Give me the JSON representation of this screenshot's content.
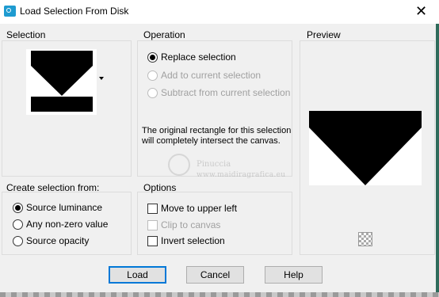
{
  "window": {
    "title": "Load Selection From Disk",
    "close_glyph": "✕",
    "app_icon": "camera-app-icon"
  },
  "selection_group": {
    "label": "Selection",
    "thumbnail_icon": "selection-thumbnail-image"
  },
  "operation_group": {
    "label": "Operation",
    "options": [
      {
        "label": "Replace selection",
        "checked": true,
        "enabled": true
      },
      {
        "label": "Add to current selection",
        "checked": false,
        "enabled": false
      },
      {
        "label": "Subtract from current selection",
        "checked": false,
        "enabled": false
      }
    ],
    "note": "The original rectangle for this selection will completely intersect the canvas."
  },
  "preview_group": {
    "label": "Preview",
    "background_toggle_icon": "checkerboard-icon"
  },
  "create_group": {
    "label": "Create selection from:",
    "options": [
      {
        "label": "Source luminance",
        "checked": true
      },
      {
        "label": "Any non-zero value",
        "checked": false
      },
      {
        "label": "Source opacity",
        "checked": false
      }
    ]
  },
  "options_group": {
    "label": "Options",
    "checkboxes": [
      {
        "label": "Move to upper left",
        "checked": false,
        "enabled": true
      },
      {
        "label": "Clip to canvas",
        "checked": false,
        "enabled": false
      },
      {
        "label": "Invert selection",
        "checked": false,
        "enabled": true
      }
    ]
  },
  "buttons": {
    "load": "Load",
    "cancel": "Cancel",
    "help": "Help"
  },
  "watermark": {
    "name": "Pinuccia",
    "site": "www.maidiragrafica.eu"
  },
  "colors": {
    "window_bg": "#f0f0f0",
    "accent": "#0078d7",
    "icon_blue": "#1e9bd0"
  }
}
